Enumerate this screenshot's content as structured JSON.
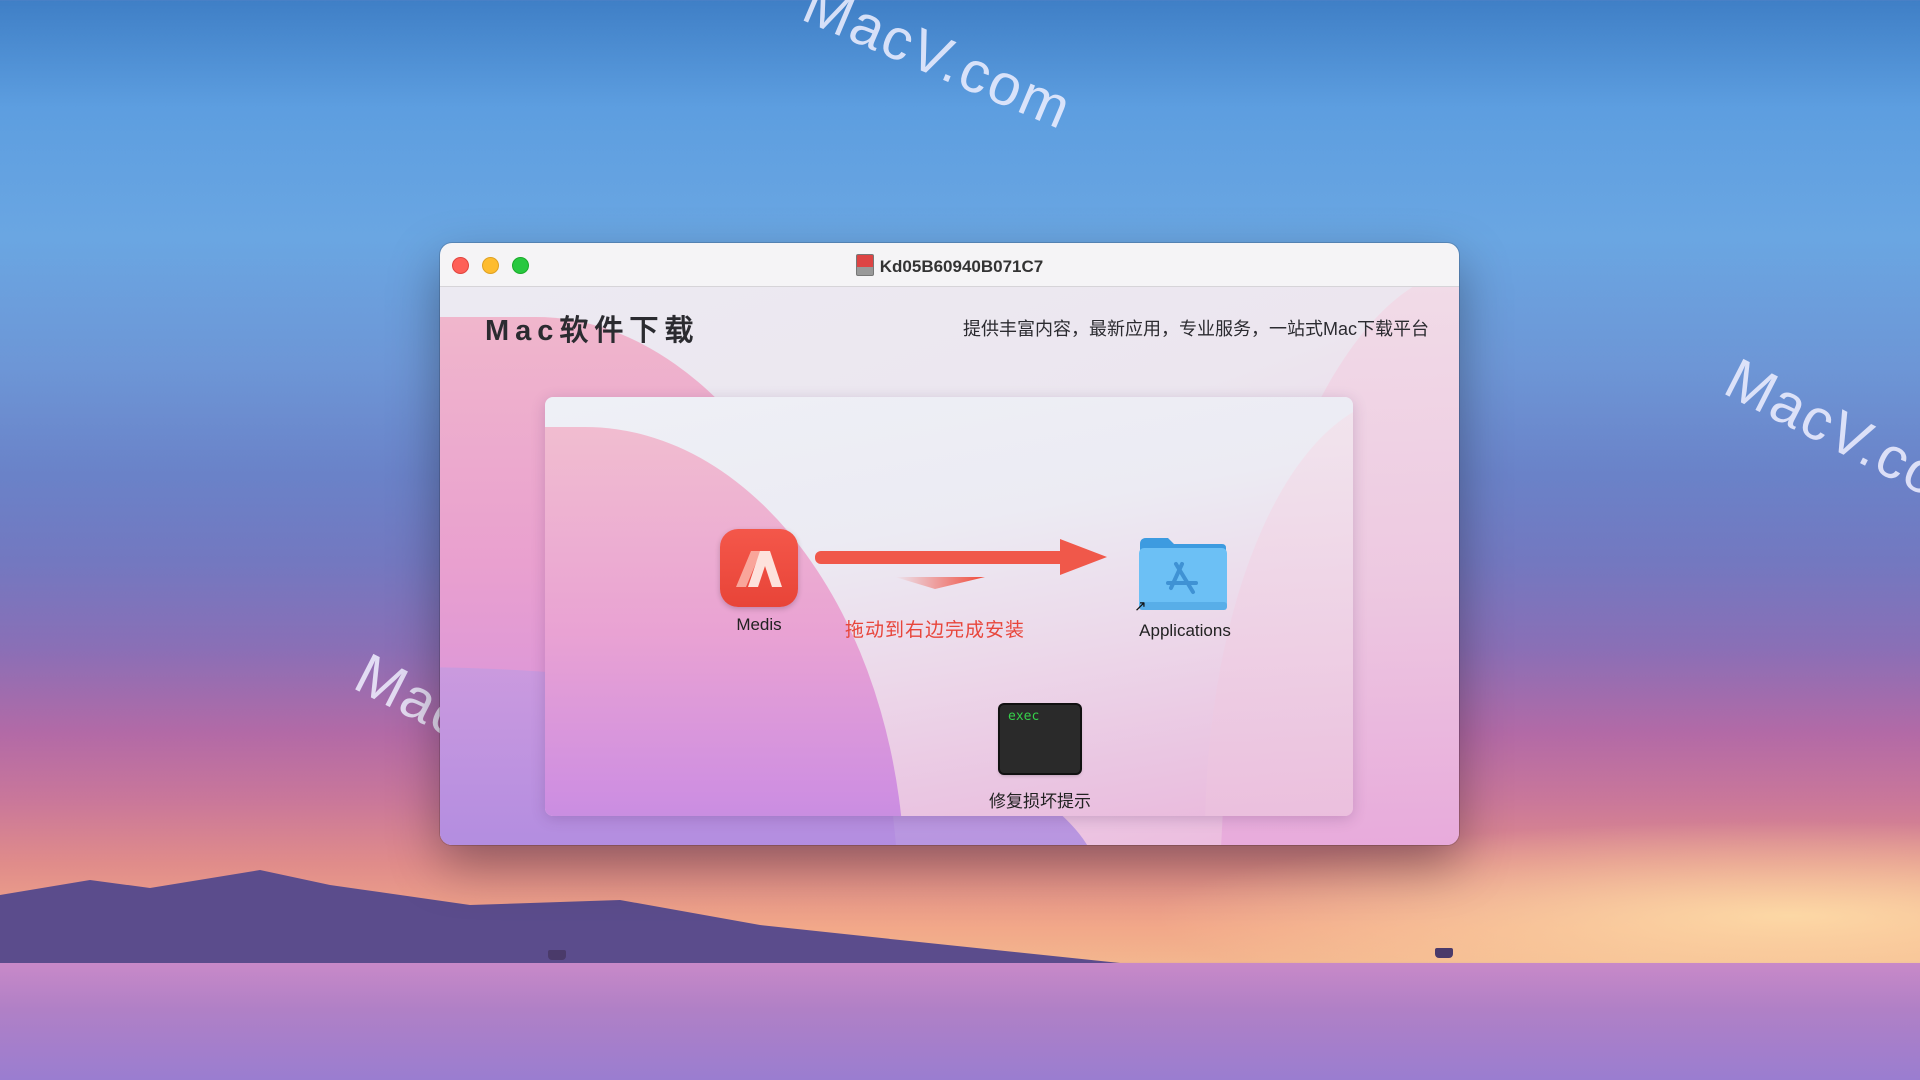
{
  "desktop": {
    "watermarks": [
      "MacV.com",
      "MacV.com",
      "MacV.com"
    ]
  },
  "window": {
    "title": "Kd05B60940B071C7",
    "title_icon": "disk-image-icon",
    "traffic_lights": [
      "close",
      "minimize",
      "zoom"
    ],
    "header": {
      "brand": "Mac软件下载",
      "slogan": "提供丰富内容，最新应用，专业服务，一站式Mac下载平台"
    },
    "installer": {
      "app": {
        "label": "Medis",
        "icon": "medis-app-icon"
      },
      "hint": "拖动到右边完成安装",
      "target": {
        "label": "Applications",
        "icon": "applications-folder-icon"
      },
      "repair": {
        "label": "修复损坏提示",
        "icon_text": "exec",
        "icon": "exec-terminal-icon"
      }
    }
  },
  "colors": {
    "accent_red": "#e8463b",
    "exec_green": "#35d04a",
    "folder_blue": "#6cc0f5"
  }
}
